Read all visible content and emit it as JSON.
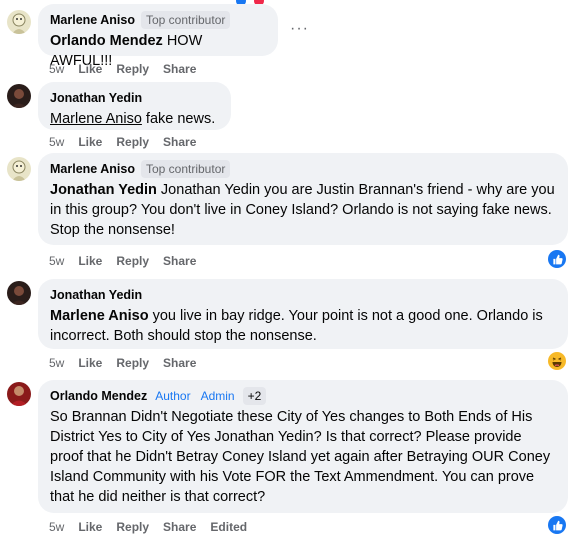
{
  "comments": [
    {
      "author": "Marlene Aniso",
      "badges": [
        "Top contributor"
      ],
      "mention": "Orlando Mendez",
      "text": " HOW AWFUL!!!",
      "time": "5w",
      "like": "Like",
      "reply": "Reply",
      "share": "Share",
      "more": "···"
    },
    {
      "author": "Jonathan Yedin",
      "mention": "Marlene Aniso",
      "text": " fake news.",
      "time": "5w",
      "like": "Like",
      "reply": "Reply",
      "share": "Share"
    },
    {
      "author": "Marlene Aniso",
      "badges": [
        "Top contributor"
      ],
      "mention": "Jonathan Yedin",
      "text": " Jonathan Yedin you are Justin Brannan's friend - why are you in this group? You don't live in Coney Island? Orlando is not saying fake news. Stop the nonsense!",
      "time": "5w",
      "like": "Like",
      "reply": "Reply",
      "share": "Share",
      "reaction": "like-reaction-icon"
    },
    {
      "author": "Jonathan Yedin",
      "mention": "Marlene Aniso",
      "text": " you live in bay ridge. Your point is not a good one. Orlando is incorrect. Both should stop the nonsense.",
      "time": "5w",
      "like": "Like",
      "reply": "Reply",
      "share": "Share",
      "reaction": "haha-reaction-icon"
    },
    {
      "author": "Orlando Mendez",
      "badges": [
        "Author",
        "Admin",
        "+2"
      ],
      "text": "So Brannan Didn't Negotiate these City of Yes changes to Both Ends of His District Yes to City of Yes Jonathan Yedin? Is that correct? Please provide proof that he Didn't Betray Coney Island yet again after Betraying OUR Coney Island Community with his Vote FOR the Text Ammendment. You can prove that he did neither is that correct?",
      "time": "5w",
      "like": "Like",
      "reply": "Reply",
      "share": "Share",
      "edited": "Edited",
      "reaction": "like-reaction-icon"
    }
  ],
  "colors": {
    "bubble": "#f0f2f5",
    "meta": "#65676b",
    "link_blue": "#1877f2",
    "like_blue": "#1877f2",
    "haha_yellow": "#f7b928"
  }
}
